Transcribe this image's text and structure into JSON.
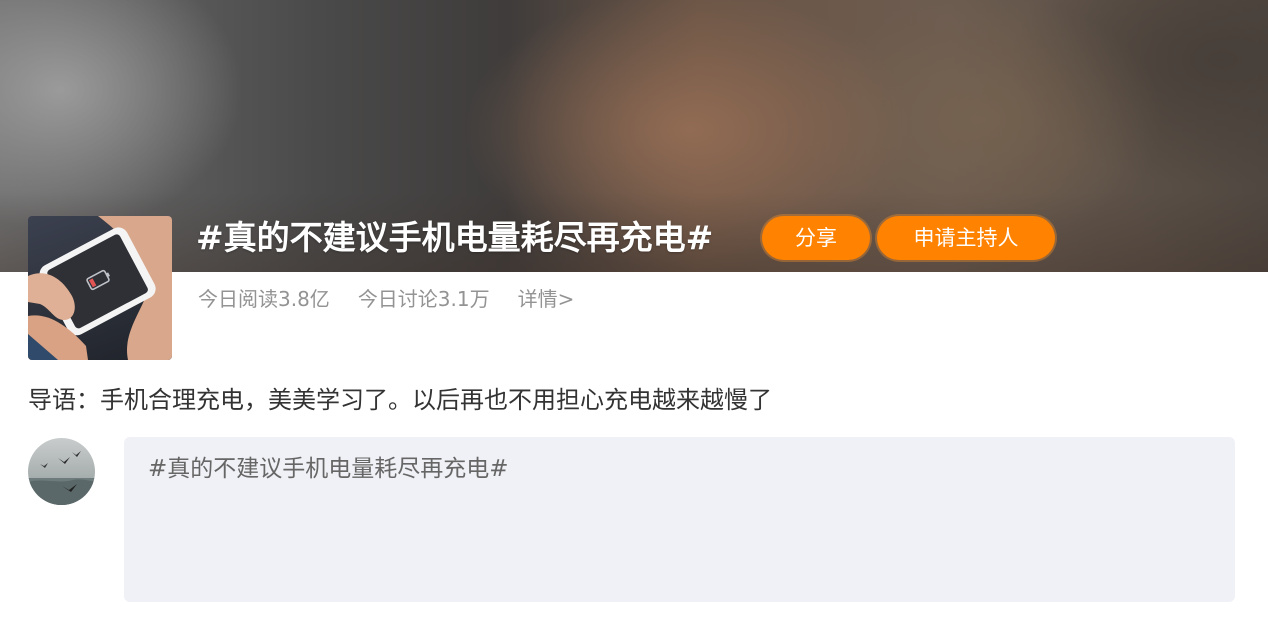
{
  "topic": {
    "title": "#真的不建议手机电量耗尽再充电#",
    "thumbnail_icon": "phone-low-battery-image"
  },
  "actions": {
    "share_label": "分享",
    "apply_host_label": "申请主持人"
  },
  "stats": {
    "today_reads": "今日阅读3.8亿",
    "today_discussions": "今日讨论3.1万",
    "details_link": "详情>"
  },
  "intro": {
    "text": "导语：手机合理充电，美美学习了。以后再也不用担心充电越来越慢了"
  },
  "composer": {
    "avatar_icon": "user-avatar-birds",
    "value": "#真的不建议手机电量耗尽再充电#"
  },
  "colors": {
    "accent": "#ff8200",
    "muted_text": "#939393",
    "composer_bg": "#f0f1f6"
  }
}
